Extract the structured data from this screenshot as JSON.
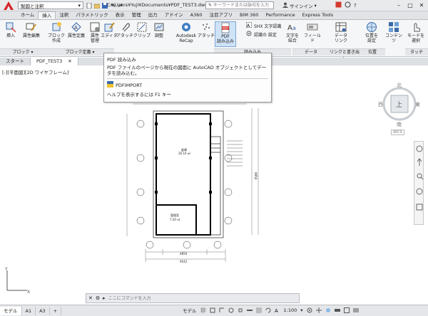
{
  "titlebar": {
    "workspace": "製図と注釈",
    "document_title": "C:¥Users¥Yuji¥Documents¥PDF_TEST3.dwg",
    "search_placeholder": "キーワードまたは語句を入力",
    "signin": "サインイン"
  },
  "ribbon_tabs": [
    "ホーム",
    "挿入",
    "注釈",
    "パラメトリック",
    "表示",
    "管理",
    "出力",
    "アドイン",
    "A360",
    "注目アプリ",
    "BIM 360",
    "Performance",
    "Express Tools"
  ],
  "ribbon": {
    "buttons": {
      "insert": "挿入",
      "edit_attributes": "属性編集",
      "create_block": "ブロック\n作成",
      "define_attributes": "属性定義",
      "manage_attributes": "属性\n管理",
      "block_editor": "エディタ",
      "attach": "アタッチ",
      "clip": "クリップ",
      "adjust": "調整",
      "recap": "Autodesk\nReCap",
      "attach2": "アタッチ",
      "pdf_import": "PDF\n読み込み",
      "shx_recognition": "SHX 文字認識",
      "recognition_settings": "認識の 設定",
      "combine_text": "文字を\n結合",
      "field": "フィールド",
      "data_link": "データ\nリンク",
      "location": "位置を\n設定",
      "content": "コンテンツ",
      "select_mode": "モードを\n選択"
    },
    "panels": {
      "block": "ブロック",
      "block_definition": "ブロック定義",
      "import": "読み込み",
      "data": "データ",
      "link_extract": "リンクと書き出し",
      "location": "位置",
      "touch": "タッチ"
    }
  },
  "file_tabs": [
    "スタート",
    "PDF_TEST3"
  ],
  "view_label": "[-][平面図][2D ワイヤフレーム]",
  "tooltip": {
    "title": "PDF 読み込み",
    "description": "PDF ファイルのページから現在の図面に AutoCAD オブジェクトとしてデータを読み込む。",
    "command": "PDFIMPORT",
    "help": "ヘルプを表示するには F1 キー"
  },
  "viewcube": {
    "north": "北",
    "south": "南",
    "east": "東",
    "west": "西",
    "top": "上",
    "wcs": "WCS"
  },
  "drawing": {
    "room1": "倉庫",
    "room1_area": "26.10 ㎡",
    "room2": "管理室",
    "room2_area": "7.20 ㎡",
    "dim_bottom_total": "9542",
    "dim_bottom_mid": "4850",
    "dim_right_total": "9950"
  },
  "commandline": {
    "placeholder": "ここにコマンドを入力"
  },
  "status": {
    "layout_tabs": [
      "モデル",
      "A1",
      "A3"
    ],
    "model_label": "モデル",
    "scale": "1:100"
  }
}
